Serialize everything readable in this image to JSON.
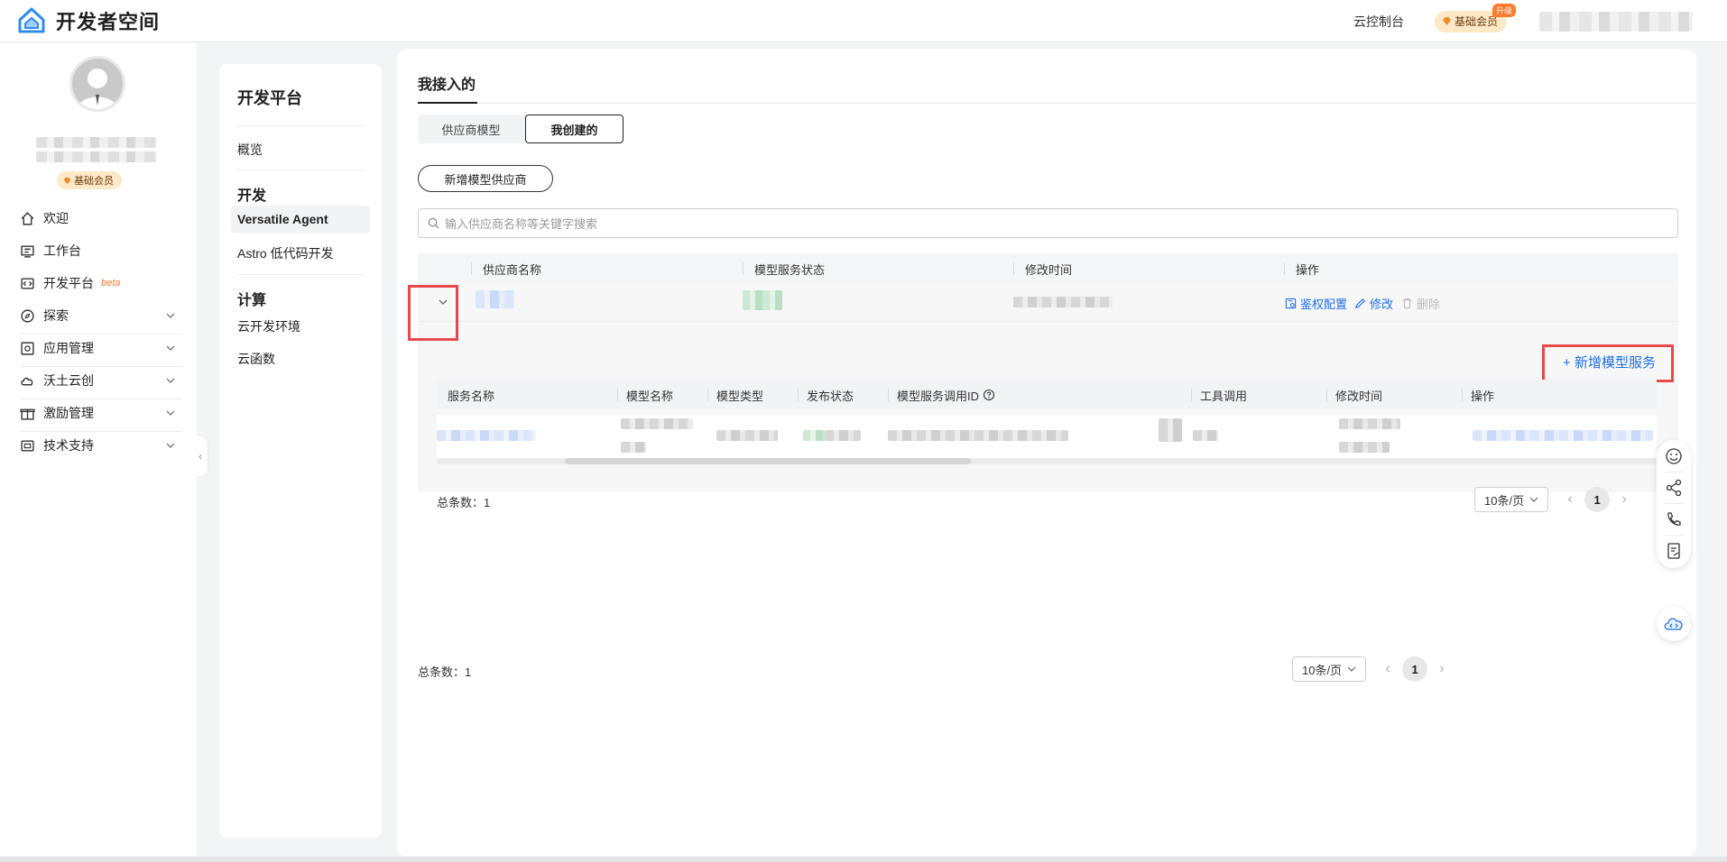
{
  "header": {
    "brand": "开发者空间",
    "console_link": "云控制台",
    "vip_label": "基础会员",
    "upgrade_tag": "升级"
  },
  "sidebar": {
    "vip_label": "基础会员",
    "items": [
      {
        "label": "欢迎",
        "icon": "home-icon"
      },
      {
        "label": "工作台",
        "icon": "desk-icon"
      },
      {
        "label": "开发平台",
        "icon": "code-icon",
        "badge": "beta"
      },
      {
        "label": "探索",
        "icon": "compass-icon"
      },
      {
        "label": "应用管理",
        "icon": "app-icon"
      },
      {
        "label": "沃土云创",
        "icon": "cloud-icon"
      },
      {
        "label": "激励管理",
        "icon": "gift-icon"
      },
      {
        "label": "技术支持",
        "icon": "support-icon"
      }
    ]
  },
  "subpanel": {
    "title": "开发平台",
    "overview": "概览",
    "dev_group": "开发",
    "versatile": "Versatile Agent",
    "astro": "Astro 低代码开发",
    "compute_group": "计算",
    "cloud_env": "云开发环境",
    "cloud_func": "云函数"
  },
  "main": {
    "tab_title": "我接入的",
    "seg_supplier": "供应商模型",
    "seg_mine": "我创建的",
    "add_provider": "新增模型供应商",
    "search_placeholder": "输入供应商名称等关键字搜索",
    "table": {
      "col_name": "供应商名称",
      "col_status": "模型服务状态",
      "col_time": "修改时间",
      "col_ops": "操作",
      "op_auth": "鉴权配置",
      "op_edit": "修改",
      "op_delete": "删除"
    },
    "add_service": "+ 新增模型服务",
    "inner": {
      "col_service": "服务名称",
      "col_model": "模型名称",
      "col_type": "模型类型",
      "col_publish": "发布状态",
      "col_callid": "模型服务调用ID",
      "col_tool": "工具调用",
      "col_time": "修改时间",
      "col_ops": "操作",
      "total": "总条数：1",
      "page_size": "10条/页",
      "page": "1"
    },
    "total": "总条数：1",
    "page_size": "10条/页",
    "page": "1"
  },
  "float_toolbar": [
    "smile-icon",
    "share-icon",
    "phone-icon",
    "feedback-icon",
    "cloud-code-icon"
  ]
}
